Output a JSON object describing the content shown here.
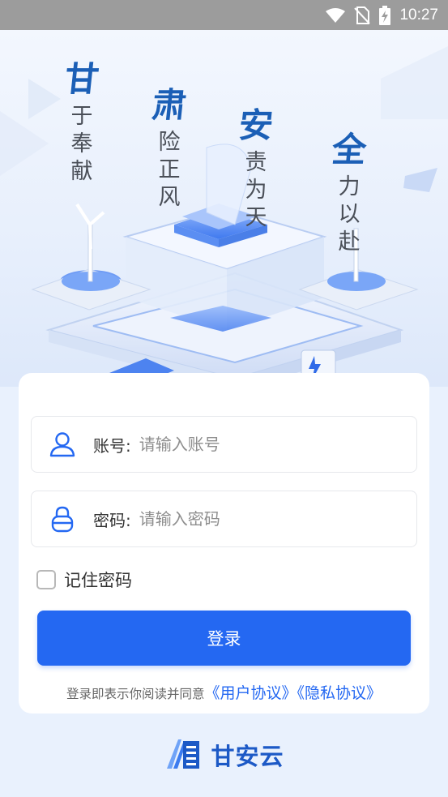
{
  "status_bar": {
    "time": "10:27",
    "icons": [
      "wifi-icon",
      "no-sim-icon",
      "battery-charging-icon"
    ]
  },
  "hero": {
    "slogans": [
      {
        "big": "甘",
        "small": "于奉献"
      },
      {
        "big": "肃",
        "small": "险正风"
      },
      {
        "big": "安",
        "small": "责为天"
      },
      {
        "big": "全",
        "small": "力以赴"
      }
    ]
  },
  "login_form": {
    "account": {
      "label": "账号:",
      "placeholder": "请输入账号",
      "value": "",
      "icon": "user-icon"
    },
    "password": {
      "label": "密码:",
      "placeholder": "请输入密码",
      "value": "",
      "icon": "lock-icon"
    },
    "remember": {
      "label": "记住密码",
      "checked": false
    },
    "submit_label": "登录",
    "agreement": {
      "prefix": "登录即表示你阅读并同意",
      "user_agreement": "《用户协议》",
      "privacy_policy": "《隐私协议》"
    }
  },
  "brand": {
    "name": "甘安云",
    "icon": "gan-an-yun-logo-icon"
  },
  "colors": {
    "primary": "#2468f2",
    "slogan_blue": "#1b5fb6",
    "background": "#e9f1fd",
    "status_bar": "#9c9c9c"
  }
}
